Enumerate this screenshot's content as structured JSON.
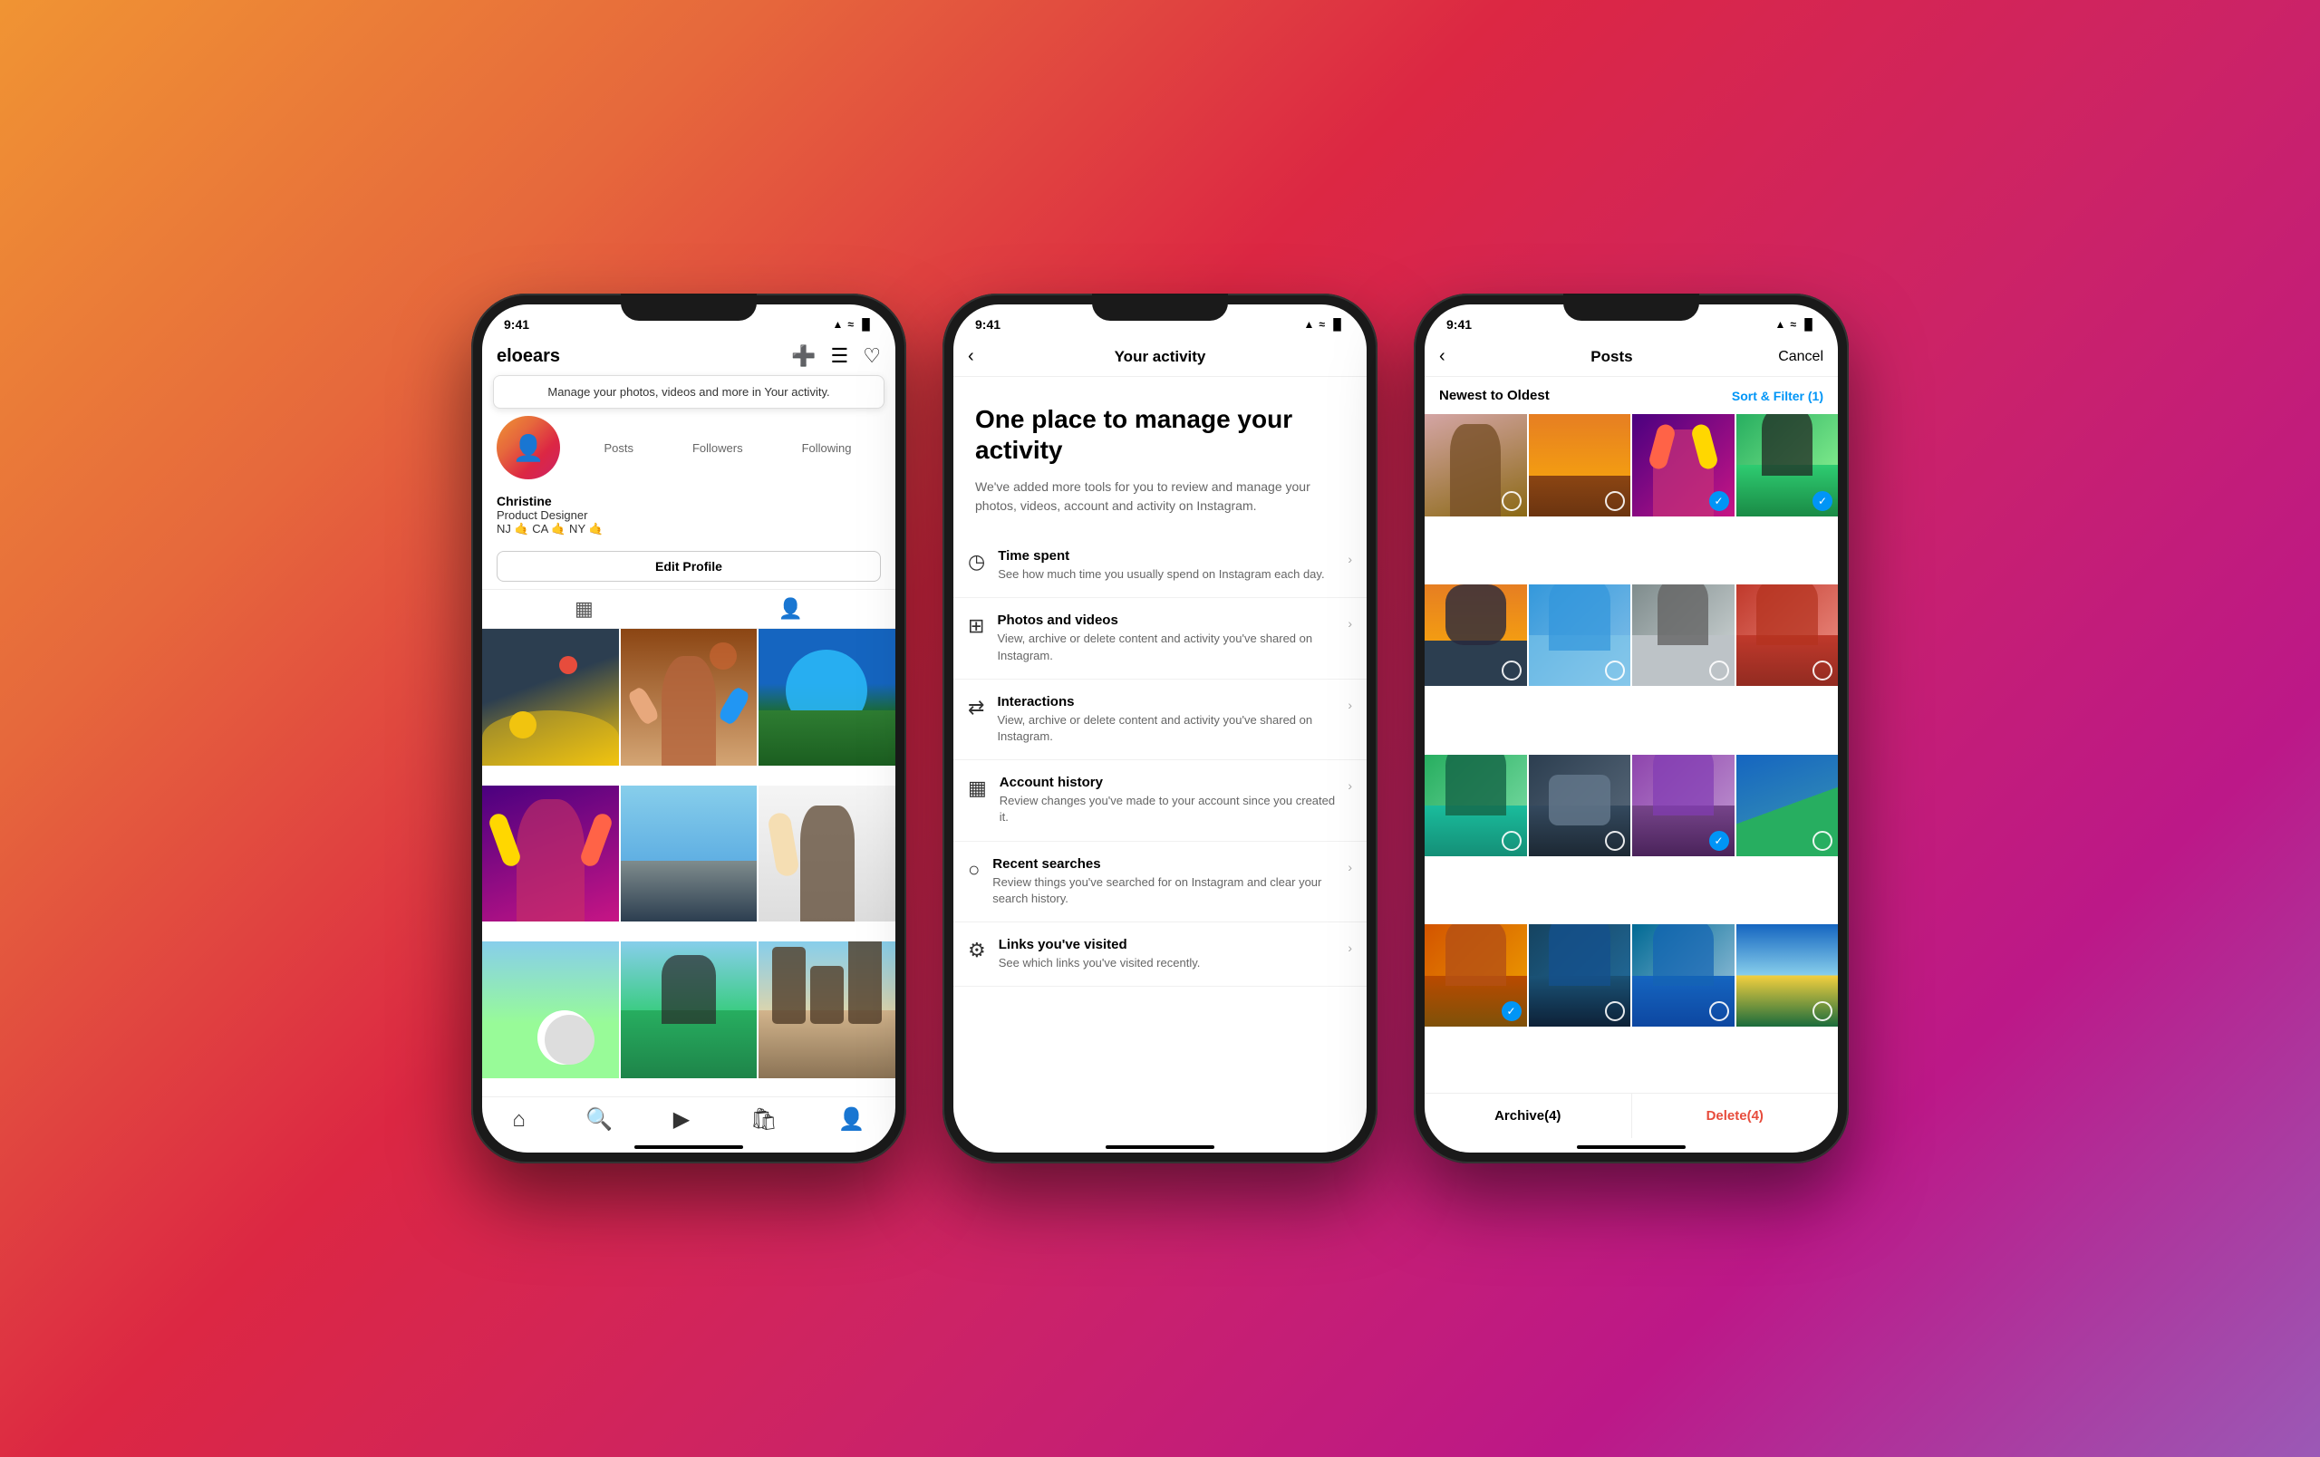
{
  "background": {
    "gradient": "linear-gradient(135deg, #f09433, #e6683c, #dc2743, #cc2366, #bc1888, #9b59b6)"
  },
  "phones": [
    {
      "id": "profile",
      "status_bar": {
        "time": "9:41",
        "icons": "▲ ≈ 🔋"
      },
      "header": {
        "username": "eloears",
        "icons": [
          "➕",
          "☰",
          "♡"
        ]
      },
      "tooltip": {
        "text": "Manage your photos, videos and more in Your activity."
      },
      "stats": {
        "posts_label": "Posts",
        "followers_label": "Followers",
        "following_label": "Following"
      },
      "profile": {
        "name": "Christine",
        "title": "Product Designer",
        "location": "NJ 🤙 CA 🤙 NY 🤙"
      },
      "edit_profile_btn": "Edit Profile",
      "bottom_nav": {
        "items": [
          "🏠",
          "🔍",
          "🎬",
          "🛍",
          "👤"
        ]
      },
      "photos": [
        {
          "id": 1,
          "color": "p1"
        },
        {
          "id": 2,
          "color": "p2"
        },
        {
          "id": 3,
          "color": "p3"
        },
        {
          "id": 4,
          "color": "p4"
        },
        {
          "id": 5,
          "color": "p5"
        },
        {
          "id": 6,
          "color": "p6"
        },
        {
          "id": 7,
          "color": "p7"
        },
        {
          "id": 8,
          "color": "p8"
        },
        {
          "id": 9,
          "color": "p9"
        }
      ]
    },
    {
      "id": "activity",
      "status_bar": {
        "time": "9:41",
        "icons": "▲ ≈ 🔋"
      },
      "header": {
        "title": "Your activity",
        "back": "‹"
      },
      "hero": {
        "title": "One place to manage your activity",
        "subtitle": "We've added more tools for you to review and manage your photos, videos, account and activity on Instagram."
      },
      "menu_items": [
        {
          "icon": "⏱",
          "title": "Time spent",
          "desc": "See how much time you usually spend on Instagram each day."
        },
        {
          "icon": "📷",
          "title": "Photos and videos",
          "desc": "View, archive or delete content and activity you've shared on Instagram."
        },
        {
          "icon": "↔",
          "title": "Interactions",
          "desc": "View, archive or delete content and activity you've shared on Instagram."
        },
        {
          "icon": "📅",
          "title": "Account history",
          "desc": "Review changes you've made to your account since you created it."
        },
        {
          "icon": "🔍",
          "title": "Recent searches",
          "desc": "Review things you've searched for on Instagram and clear your search history."
        },
        {
          "icon": "🔗",
          "title": "Links you've visited",
          "desc": "See which links you've visited recently."
        }
      ]
    },
    {
      "id": "posts",
      "status_bar": {
        "time": "9:41",
        "icons": "▲ ≈ 🔋"
      },
      "header": {
        "back": "‹",
        "title": "Posts",
        "cancel": "Cancel"
      },
      "filter": {
        "label": "Newest to Oldest",
        "btn": "Sort & Filter (1)"
      },
      "photos": [
        {
          "id": 1,
          "color": "g1",
          "selected": false
        },
        {
          "id": 2,
          "color": "g2",
          "selected": false
        },
        {
          "id": 3,
          "color": "g3",
          "selected": true
        },
        {
          "id": 4,
          "color": "g4",
          "selected": true
        },
        {
          "id": 5,
          "color": "g5",
          "selected": false
        },
        {
          "id": 6,
          "color": "g6",
          "selected": false
        },
        {
          "id": 7,
          "color": "g7",
          "selected": false
        },
        {
          "id": 8,
          "color": "g8",
          "selected": false
        },
        {
          "id": 9,
          "color": "g9",
          "selected": false
        },
        {
          "id": 10,
          "color": "g10",
          "selected": false
        },
        {
          "id": 11,
          "color": "g11",
          "selected": false
        },
        {
          "id": 12,
          "color": "g12",
          "selected": true
        },
        {
          "id": 13,
          "color": "g13",
          "selected": true
        },
        {
          "id": 14,
          "color": "g14",
          "selected": false
        },
        {
          "id": 15,
          "color": "g15",
          "selected": false
        },
        {
          "id": 16,
          "color": "g16",
          "selected": false
        }
      ],
      "bottom": {
        "archive": "Archive(4)",
        "delete": "Delete(4)"
      }
    }
  ]
}
